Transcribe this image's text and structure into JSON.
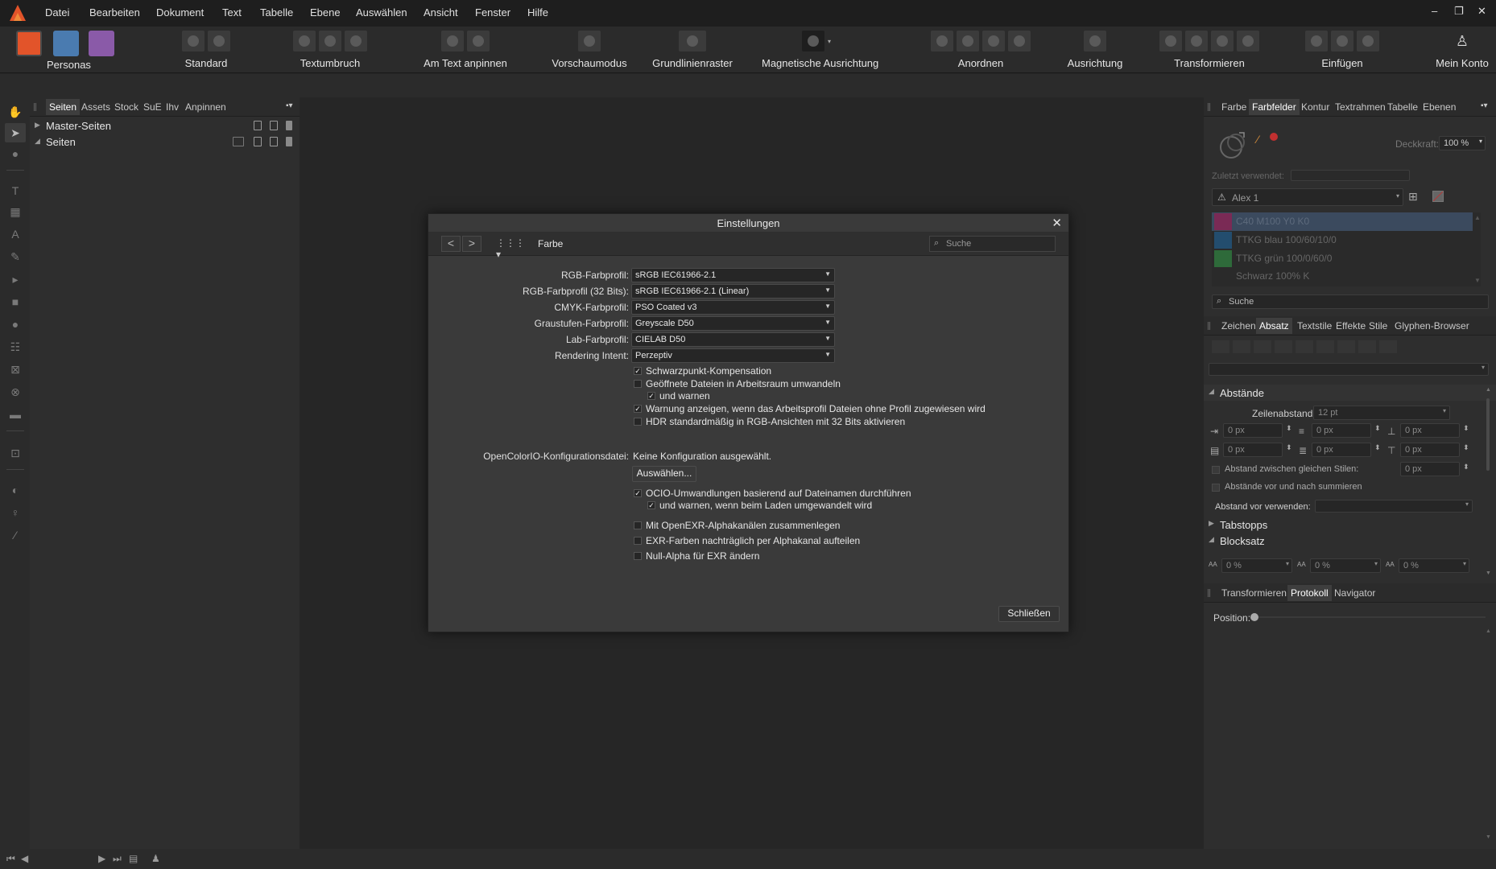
{
  "menu": [
    "Datei",
    "Bearbeiten",
    "Dokument",
    "Text",
    "Tabelle",
    "Ebene",
    "Auswählen",
    "Ansicht",
    "Fenster",
    "Hilfe"
  ],
  "window_controls": {
    "minimize": "–",
    "restore": "❐",
    "close": "✕"
  },
  "toolbar": {
    "personas": "Personas",
    "groups": [
      "Standard",
      "Textumbruch",
      "Am Text anpinnen",
      "Vorschaumodus",
      "Grundlinienraster",
      "Magnetische Ausrichtung",
      "Anordnen",
      "Ausrichtung",
      "Transformieren",
      "Einfügen",
      "Mein Konto"
    ]
  },
  "left_panel": {
    "tabs": [
      "Seiten",
      "Assets",
      "Stock",
      "SuE",
      "Ihv",
      "Anpinnen"
    ],
    "rows": [
      "Master-Seiten",
      "Seiten"
    ]
  },
  "right_panel": {
    "top_tabs": [
      "Farbe",
      "Farbfelder",
      "Kontur",
      "Textrahmen",
      "Tabelle",
      "Ebenen"
    ],
    "opacity_label": "Deckkraft:",
    "opacity_value": "100 %",
    "recent_label": "Zuletzt verwendet:",
    "palette": "Alex 1",
    "swatches": [
      {
        "name": "C40 M100 Y0 K0",
        "color": "#7a2a55"
      },
      {
        "name": "TTKG blau 100/60/10/0",
        "color": "#234d6e"
      },
      {
        "name": "TTKG grün 100/0/60/0",
        "color": "#2e6a3a"
      },
      {
        "name": "Schwarz 100% K",
        "color": "#2a2a2a"
      }
    ],
    "search": "Suche",
    "mid_tabs": [
      "Zeichen",
      "Absatz",
      "Textstile",
      "Effekte",
      "Stile",
      "Glyphen-Browser"
    ],
    "section_spacing": "Abstände",
    "line_spacing_label": "Zeilenabstand:",
    "line_spacing_value": "12 pt",
    "px": "0 px",
    "same_style_label": "Abstand zwischen gleichen Stilen:",
    "sum_label": "Abstände vor und nach summieren",
    "use_before_label": "Abstand vor verwenden:",
    "section_tabs": "Tabstopps",
    "section_justify": "Blocksatz",
    "percent": "0 %",
    "bottom_tabs": [
      "Transformieren",
      "Protokoll",
      "Navigator"
    ],
    "position_label": "Position:"
  },
  "dialog": {
    "title": "Einstellungen",
    "close": "✕",
    "breadcrumb": "Farbe",
    "search_placeholder": "Suche",
    "profiles": [
      {
        "label": "RGB-Farbprofil:",
        "value": "sRGB IEC61966-2.1"
      },
      {
        "label": "RGB-Farbprofil (32 Bits):",
        "value": "sRGB IEC61966-2.1 (Linear)"
      },
      {
        "label": "CMYK-Farbprofil:",
        "value": "PSO Coated v3"
      },
      {
        "label": "Graustufen-Farbprofil:",
        "value": "Greyscale D50"
      },
      {
        "label": "Lab-Farbprofil:",
        "value": "CIELAB D50"
      },
      {
        "label": "Rendering Intent:",
        "value": "Perzeptiv"
      }
    ],
    "checks1": [
      {
        "label": "Schwarzpunkt-Kompensation",
        "checked": true,
        "indent": false
      },
      {
        "label": "Geöffnete Dateien in Arbeitsraum umwandeln",
        "checked": false,
        "indent": false
      },
      {
        "label": "und warnen",
        "checked": true,
        "indent": true
      },
      {
        "label": "Warnung anzeigen, wenn das Arbeitsprofil Dateien ohne Profil zugewiesen wird",
        "checked": true,
        "indent": false
      },
      {
        "label": "HDR standardmäßig in RGB-Ansichten mit 32 Bits aktivieren",
        "checked": false,
        "indent": false
      }
    ],
    "ocio_label": "OpenColorIO-Konfigurationsdatei:",
    "ocio_value": "Keine Konfiguration ausgewählt.",
    "select_button": "Auswählen...",
    "checks2": [
      {
        "label": "OCIO-Umwandlungen basierend auf Dateinamen durchführen",
        "checked": true,
        "indent": false
      },
      {
        "label": "und warnen, wenn beim Laden umgewandelt wird",
        "checked": true,
        "indent": true
      }
    ],
    "checks3": [
      {
        "label": "Mit OpenEXR-Alphakanälen zusammenlegen",
        "checked": false
      },
      {
        "label": "EXR-Farben nachträglich per Alphakanal aufteilen",
        "checked": false
      },
      {
        "label": "Null-Alpha für EXR ändern",
        "checked": false
      }
    ],
    "close_button": "Schließen"
  },
  "colors": {
    "accent_selection": "#3b4a5e",
    "app_bg": "#262626",
    "panel_bg": "#2e2e2e"
  }
}
